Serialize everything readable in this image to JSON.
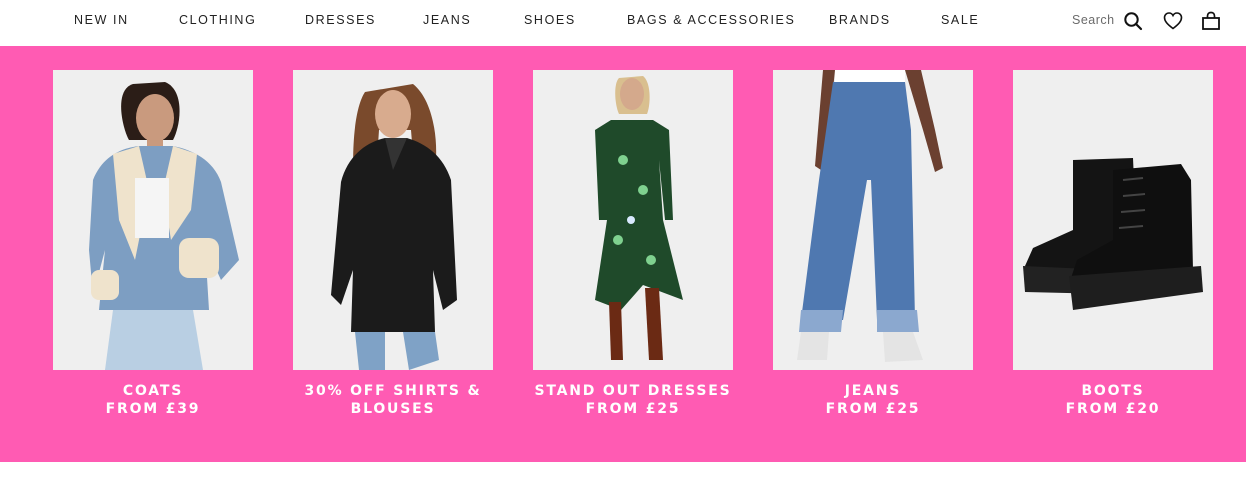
{
  "nav": {
    "items": [
      {
        "label": "NEW IN",
        "key": "new-in"
      },
      {
        "label": "CLOTHING",
        "key": "clothing"
      },
      {
        "label": "DRESSES",
        "key": "dresses"
      },
      {
        "label": "JEANS",
        "key": "jeans"
      },
      {
        "label": "SHOES",
        "key": "shoes"
      },
      {
        "label": "BAGS & ACCESSORIES",
        "key": "bags-accessories"
      },
      {
        "label": "BRANDS",
        "key": "brands"
      },
      {
        "label": "SALE",
        "key": "sale"
      }
    ],
    "search_label": "Search",
    "icons": [
      "search-icon",
      "wishlist-heart-icon",
      "shopping-bag-icon"
    ]
  },
  "promo": {
    "background_color": "#ff5bb3",
    "tiles": [
      {
        "line1": "COATS",
        "line2": "FROM £39",
        "image": "denim-shearling-coat-photo"
      },
      {
        "line1": "30% OFF SHIRTS &",
        "line2": "BLOUSES",
        "image": "black-leather-shirt-photo"
      },
      {
        "line1": "STAND OUT DRESSES",
        "line2": "FROM £25",
        "image": "green-floral-dress-photo"
      },
      {
        "line1": "JEANS",
        "line2": "FROM £25",
        "image": "blue-wide-leg-jeans-photo"
      },
      {
        "line1": "BOOTS",
        "line2": "FROM £20",
        "image": "black-chunky-boots-photo"
      }
    ]
  }
}
